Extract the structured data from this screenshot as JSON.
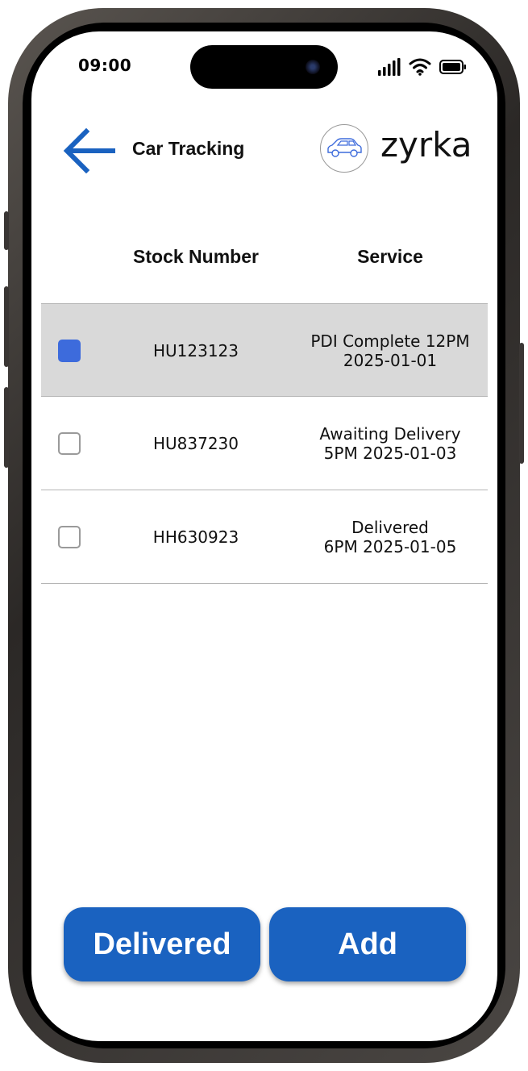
{
  "status": {
    "time": "09:00"
  },
  "header": {
    "title": "Car Tracking",
    "brand": "zyrka"
  },
  "table": {
    "columns": [
      "Stock Number",
      "Service"
    ],
    "rows": [
      {
        "stock": "HU123123",
        "service_line1": "PDI Complete 12PM",
        "service_line2": "2025-01-01",
        "checked": true
      },
      {
        "stock": "HU837230",
        "service_line1": "Awaiting Delivery",
        "service_line2": "5PM 2025-01-03",
        "checked": false
      },
      {
        "stock": "HH630923",
        "service_line1": "Delivered",
        "service_line2": "6PM 2025-01-05",
        "checked": false
      }
    ]
  },
  "actions": {
    "delivered_label": "Delivered",
    "add_label": "Add"
  },
  "colors": {
    "accent": "#1a62c0",
    "checkbox_checked": "#3d6bdc",
    "selected_row": "#d9d9d9"
  },
  "icons": {
    "back": "arrow-left-icon",
    "logo": "car-logo-icon",
    "signal": "signal-icon",
    "wifi": "wifi-icon",
    "battery": "battery-icon"
  }
}
